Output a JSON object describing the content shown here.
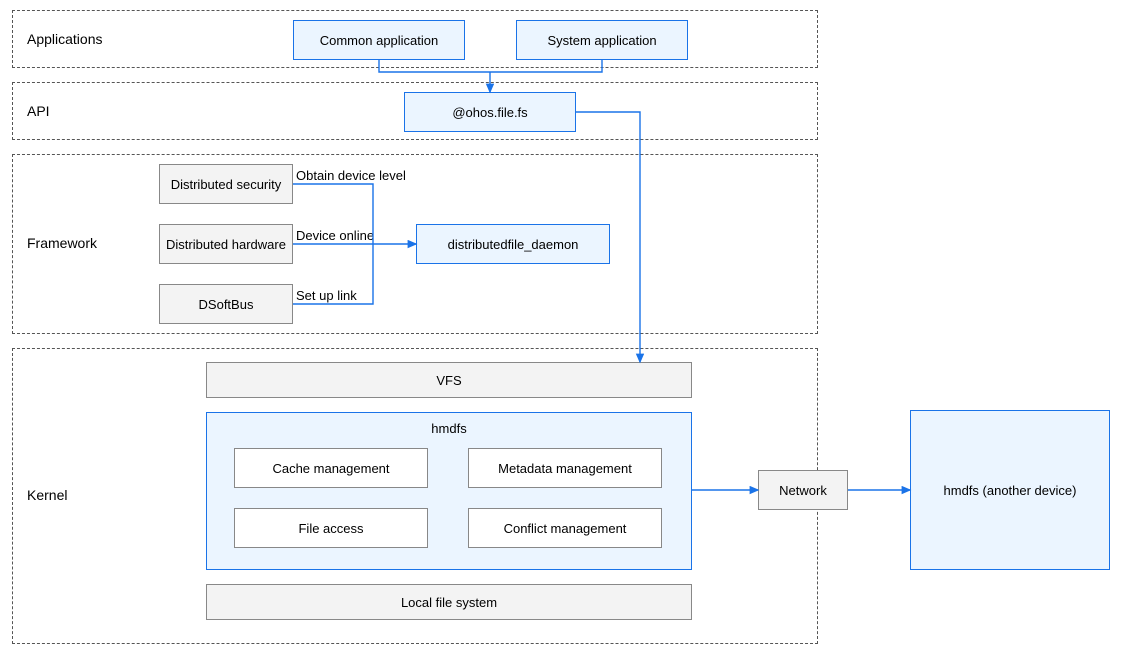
{
  "layers": {
    "applications": {
      "label": "Applications"
    },
    "api": {
      "label": "API"
    },
    "framework": {
      "label": "Framework"
    },
    "kernel": {
      "label": "Kernel"
    }
  },
  "boxes": {
    "common_app": "Common application",
    "system_app": "System application",
    "ohos_file_fs": "@ohos.file.fs",
    "dist_security": "Distributed security",
    "dist_hardware": "Distributed hardware",
    "dsoftbus": "DSoftBus",
    "dist_daemon": "distributedfile_daemon",
    "vfs": "VFS",
    "hmdfs_title": "hmdfs",
    "cache_mgmt": "Cache management",
    "metadata_mgmt": "Metadata management",
    "file_access": "File access",
    "conflict_mgmt": "Conflict management",
    "local_fs": "Local file system",
    "network": "Network",
    "hmdfs_remote": "hmdfs (another device)"
  },
  "labels": {
    "obtain_device_level": "Obtain device level",
    "device_online": "Device online",
    "setup_link": "Set up link"
  }
}
